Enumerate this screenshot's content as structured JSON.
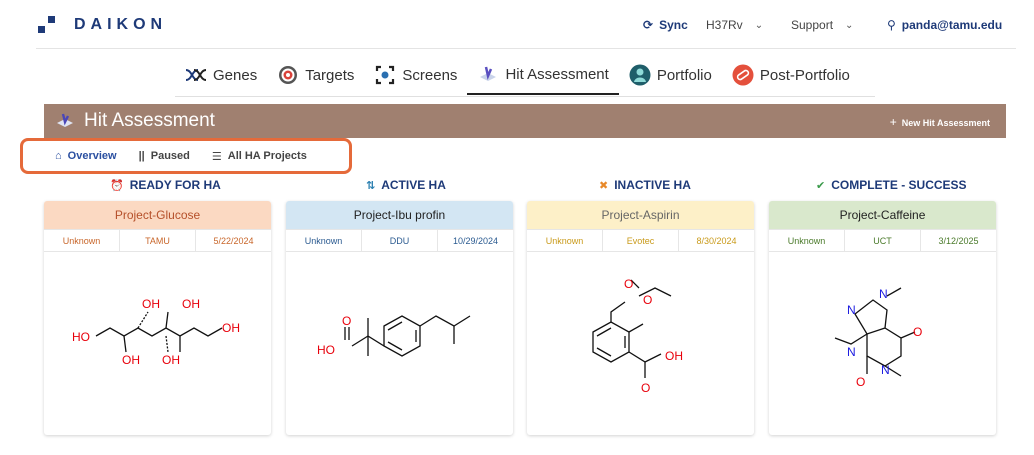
{
  "app": {
    "name": "DAIKON"
  },
  "topbar": {
    "sync_label": "Sync",
    "strain": "H37Rv",
    "support": "Support",
    "user": "panda@tamu.edu"
  },
  "tabs": [
    {
      "label": "Genes"
    },
    {
      "label": "Targets"
    },
    {
      "label": "Screens"
    },
    {
      "label": "Hit Assessment"
    },
    {
      "label": "Portfolio"
    },
    {
      "label": "Post-Portfolio"
    }
  ],
  "banner": {
    "title": "Hit Assessment",
    "new_button": "New Hit Assessment"
  },
  "subnav": [
    {
      "label": "Overview"
    },
    {
      "label": "Paused"
    },
    {
      "label": "All HA Projects"
    }
  ],
  "columns": [
    {
      "heading": "READY FOR HA",
      "card": {
        "title": "Project-Glucose",
        "status": "Unknown",
        "org": "TAMU",
        "date": "5/22/2024"
      }
    },
    {
      "heading": "ACTIVE HA",
      "card": {
        "title": "Project-Ibu profin",
        "status": "Unknown",
        "org": "DDU",
        "date": "10/29/2024"
      }
    },
    {
      "heading": "INACTIVE HA",
      "card": {
        "title": "Project-Aspirin",
        "status": "Unknown",
        "org": "Evotec",
        "date": "8/30/2024"
      }
    },
    {
      "heading": "COMPLETE - SUCCESS",
      "card": {
        "title": "Project-Caffeine",
        "status": "Unknown",
        "org": "UCT",
        "date": "3/12/2025"
      }
    }
  ],
  "molecules": {
    "glucose": {
      "oh1": "OH",
      "oh2": "OH",
      "oh3": "HO",
      "oh4": "OH",
      "oh5": "OH",
      "oh6": "OH"
    },
    "ibuprofen": {
      "o": "O",
      "oh": "HO"
    },
    "aspirin": {
      "o1": "O",
      "o2": "O",
      "o3": "O",
      "oh": "OH"
    },
    "caffeine": {
      "n1": "N",
      "n2": "N",
      "n3": "N",
      "n4": "N",
      "o1": "O",
      "o2": "O"
    }
  },
  "colors": {
    "brand": "#1e3a78",
    "banner": "#a08070",
    "highlight": "#e56a3a",
    "ready_bg": "#fbd9c2",
    "active_bg": "#d3e6f3",
    "inactive_bg": "#fdf0c8",
    "complete_bg": "#d9e8cc"
  }
}
